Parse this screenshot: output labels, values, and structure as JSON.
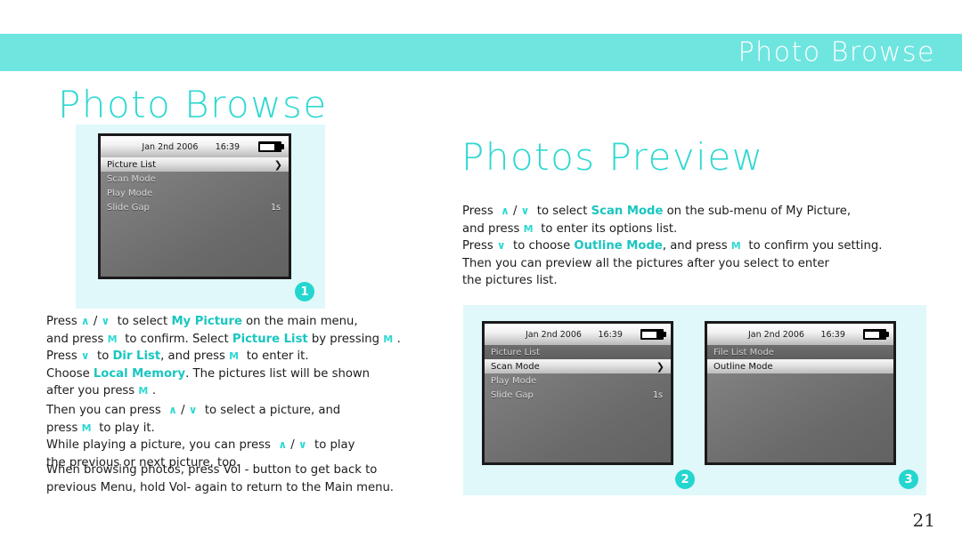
{
  "banner": {
    "title": "Photo Browse",
    "color": "#6fe5e0"
  },
  "headings": {
    "left": "Photo Browse",
    "right": "Photos Preview"
  },
  "colors": {
    "accent_teal": "#2fd8d2",
    "banner_teal": "#6fe5e0",
    "panel_blue": "#e0f8fa",
    "badge_teal": "#24d6cf",
    "highlight_text": "#19c6c0"
  },
  "devices": [
    {
      "id": "device-1",
      "status": {
        "date": "Jan 2nd 2006",
        "time": "16:39",
        "battery": "battery-icon"
      },
      "rows": [
        {
          "label": "Picture List",
          "value": "",
          "state": "selected",
          "arrow": "❯"
        },
        {
          "label": "Scan Mode",
          "value": "",
          "state": "normal",
          "arrow": ""
        },
        {
          "label": "Play Mode",
          "value": "",
          "state": "normal",
          "arrow": ""
        },
        {
          "label": "Slide Gap",
          "value": "1s",
          "state": "normal",
          "arrow": ""
        }
      ]
    },
    {
      "id": "device-2",
      "status": {
        "date": "Jan 2nd 2006",
        "time": "16:39",
        "battery": "battery-icon"
      },
      "rows": [
        {
          "label": "Picture List",
          "value": "",
          "state": "dim",
          "arrow": ""
        },
        {
          "label": "Scan Mode",
          "value": "",
          "state": "selected",
          "arrow": "❯"
        },
        {
          "label": "Play Mode",
          "value": "",
          "state": "normal",
          "arrow": ""
        },
        {
          "label": "Slide Gap",
          "value": "1s",
          "state": "normal",
          "arrow": ""
        }
      ]
    },
    {
      "id": "device-3",
      "status": {
        "date": "Jan 2nd 2006",
        "time": "16:39",
        "battery": "battery-icon"
      },
      "rows": [
        {
          "label": "File List Mode",
          "value": "",
          "state": "dim",
          "arrow": ""
        },
        {
          "label": "Outline Mode",
          "value": "",
          "state": "selected",
          "arrow": ""
        }
      ]
    }
  ],
  "text": {
    "left_paragraph_1": [
      {
        "t": "Press "
      },
      {
        "t": "∧",
        "c": "chev"
      },
      {
        "t": " / "
      },
      {
        "t": "∨",
        "c": "chev"
      },
      {
        "t": "  to select "
      },
      {
        "t": "My Picture",
        "c": "hl"
      },
      {
        "t": " on the main menu,\nand press "
      },
      {
        "t": "M",
        "c": "key"
      },
      {
        "t": "  to confirm. Select "
      },
      {
        "t": "Picture List",
        "c": "hl"
      },
      {
        "t": " by pressing "
      },
      {
        "t": "M",
        "c": "key"
      },
      {
        "t": " .\nPress "
      },
      {
        "t": "∨",
        "c": "chev"
      },
      {
        "t": "  to "
      },
      {
        "t": "Dir List",
        "c": "hl"
      },
      {
        "t": ", and press "
      },
      {
        "t": "M",
        "c": "key"
      },
      {
        "t": "  to enter it.\nChoose "
      },
      {
        "t": "Local Memory",
        "c": "hl"
      },
      {
        "t": ". The pictures list will be shown\nafter you press "
      },
      {
        "t": "M",
        "c": "key"
      },
      {
        "t": " ."
      }
    ],
    "left_paragraph_2": [
      {
        "t": "Then you can press  "
      },
      {
        "t": "∧",
        "c": "chev"
      },
      {
        "t": " / "
      },
      {
        "t": "∨",
        "c": "chev"
      },
      {
        "t": "  to select a picture, and\npress "
      },
      {
        "t": "M",
        "c": "key"
      },
      {
        "t": "  to play it.\nWhile playing a picture, you can press  "
      },
      {
        "t": "∧",
        "c": "chev"
      },
      {
        "t": " / "
      },
      {
        "t": "∨",
        "c": "chev"
      },
      {
        "t": "  to play\nthe previous or next picture, too."
      }
    ],
    "left_paragraph_3": [
      {
        "t": "When browsing photos, press Vol - button to get back to\nprevious Menu, hold Vol- again to return to the Main menu."
      }
    ],
    "right_paragraph_1": [
      {
        "t": "Press  "
      },
      {
        "t": "∧",
        "c": "chev"
      },
      {
        "t": " / "
      },
      {
        "t": "∨",
        "c": "chev"
      },
      {
        "t": "  to select "
      },
      {
        "t": "Scan Mode",
        "c": "hl"
      },
      {
        "t": " on the sub-menu of My Picture,\nand press "
      },
      {
        "t": "M",
        "c": "key"
      },
      {
        "t": "  to enter its options list.\nPress "
      },
      {
        "t": "∨",
        "c": "chev"
      },
      {
        "t": "  to choose "
      },
      {
        "t": "Outline Mode",
        "c": "hl"
      },
      {
        "t": ", and press "
      },
      {
        "t": "M",
        "c": "key"
      },
      {
        "t": "  to confirm you setting.\nThen you can preview all the pictures after you select to enter\nthe pictures list."
      }
    ]
  },
  "badges": [
    {
      "number": "1"
    },
    {
      "number": "2"
    },
    {
      "number": "3"
    }
  ],
  "page_number": "21"
}
